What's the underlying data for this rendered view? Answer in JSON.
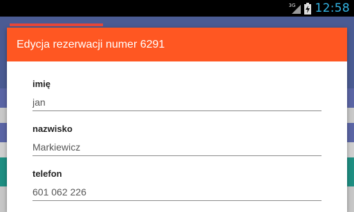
{
  "status_bar": {
    "network_label": "3G",
    "clock": "12:58",
    "icons": [
      "signal-icon",
      "battery-charging-icon"
    ],
    "clock_color": "#33b5e5"
  },
  "background": {
    "toolbar_color": "#4a5b93",
    "accent_color": "#e7473a"
  },
  "dialog": {
    "title": "Edycja rezerwacji numer 6291",
    "header_color": "#ff5722",
    "fields": [
      {
        "label": "imię",
        "value": "jan"
      },
      {
        "label": "nazwisko",
        "value": "Markiewicz"
      },
      {
        "label": "telefon",
        "value": "601 062 226"
      }
    ]
  }
}
